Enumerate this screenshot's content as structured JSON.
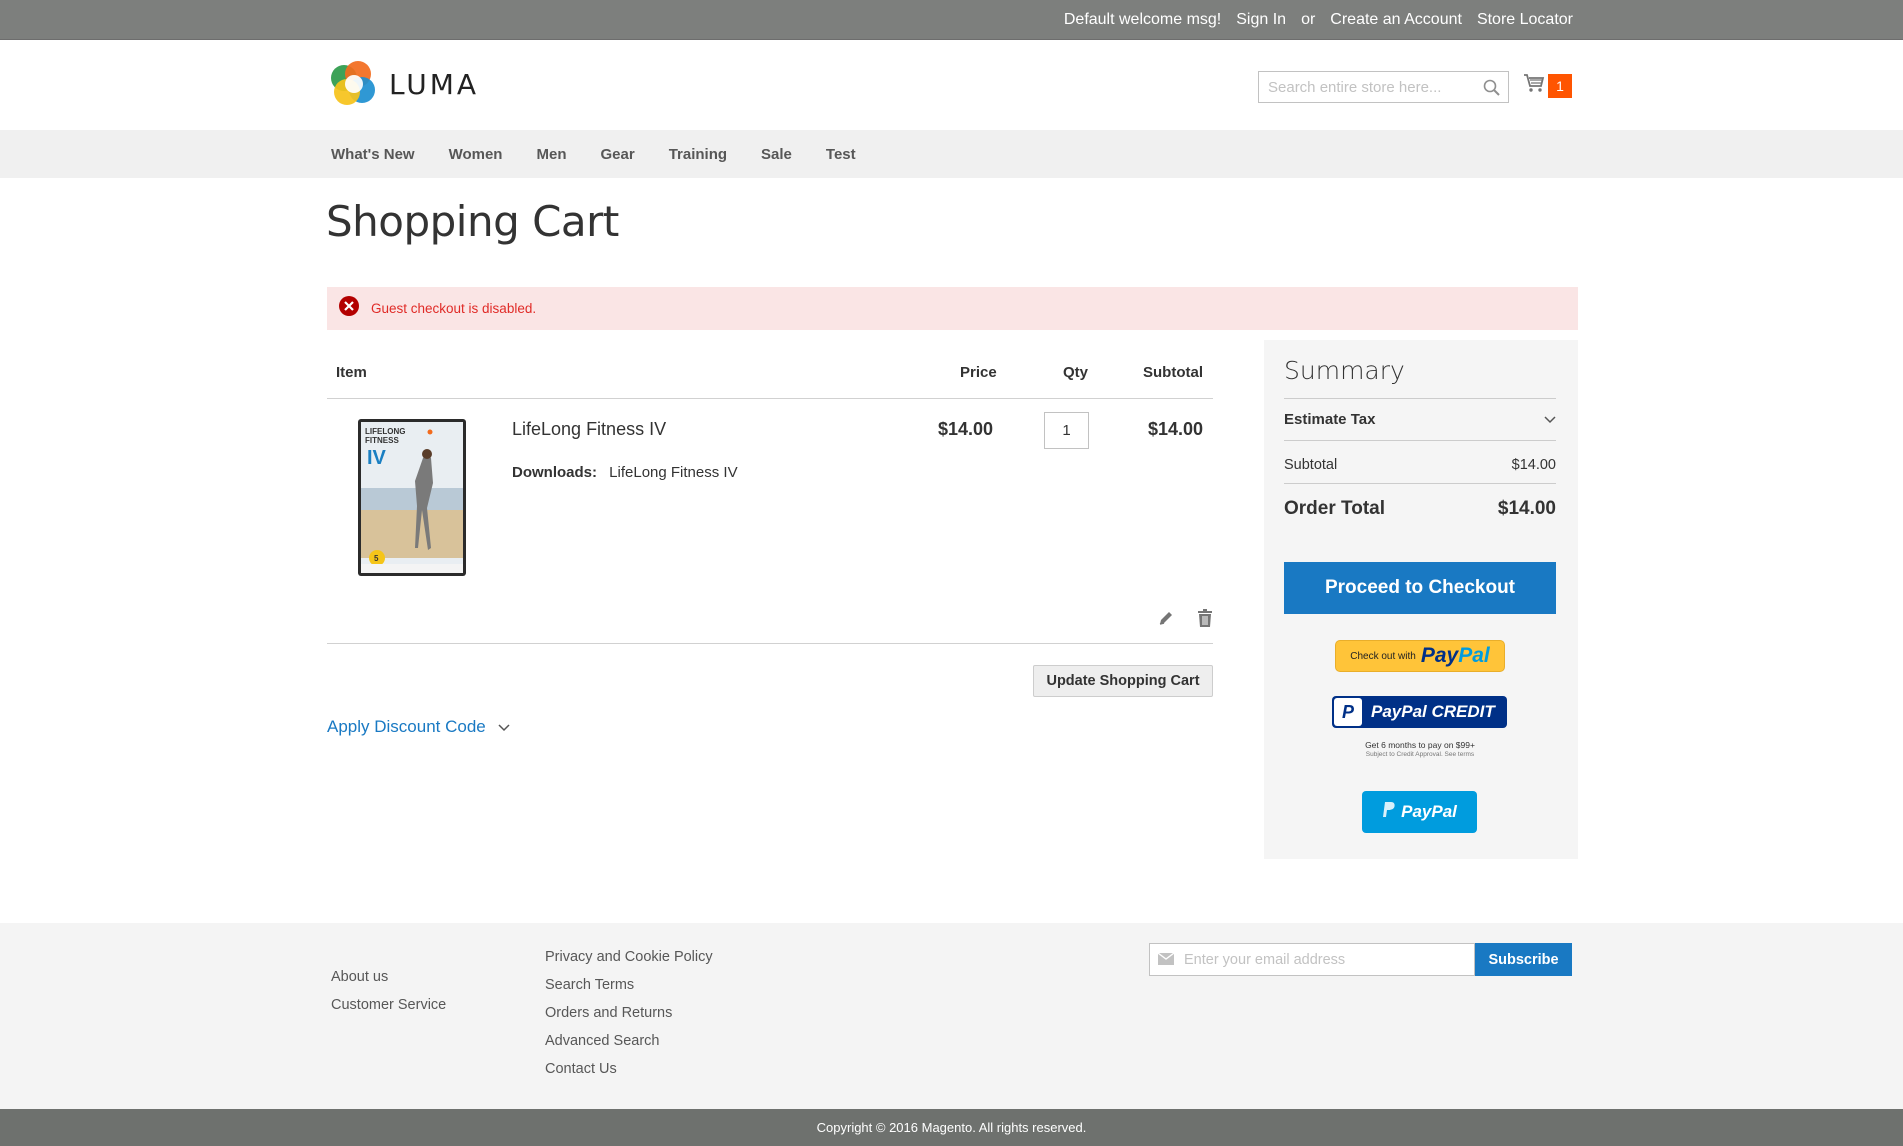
{
  "top_panel": {
    "welcome": "Default welcome msg!",
    "sign_in": "Sign In",
    "or": "or",
    "create_account": "Create an Account",
    "store_locator": "Store Locator"
  },
  "header": {
    "logo_text": "LUMA",
    "search_placeholder": "Search entire store here...",
    "cart_count": "1"
  },
  "nav": {
    "items": [
      "What's New",
      "Women",
      "Men",
      "Gear",
      "Training",
      "Sale",
      "Test"
    ]
  },
  "page": {
    "title": "Shopping Cart",
    "error_message": "Guest checkout is disabled."
  },
  "cart": {
    "headers": {
      "item": "Item",
      "price": "Price",
      "qty": "Qty",
      "subtotal": "Subtotal"
    },
    "items": [
      {
        "name": "LifeLong Fitness IV",
        "downloads_label": "Downloads:",
        "downloads_value": "LifeLong Fitness IV",
        "price": "$14.00",
        "qty": "1",
        "subtotal": "$14.00"
      }
    ],
    "update_label": "Update Shopping Cart",
    "discount_label": "Apply Discount Code"
  },
  "summary": {
    "title": "Summary",
    "estimate_tax": "Estimate Tax",
    "subtotal_label": "Subtotal",
    "subtotal_value": "$14.00",
    "order_total_label": "Order Total",
    "order_total_value": "$14.00",
    "checkout_label": "Proceed to Checkout",
    "paypal_checkout_small": "Check out with",
    "paypal_word_1": "Pay",
    "paypal_word_2": "Pal",
    "paypal_credit": "PayPal CREDIT",
    "paypal_credit_note": "Get 6 months to pay on $99+",
    "paypal_credit_subnote": "Subject to Credit Approval. See terms",
    "paypal_button": "PayPal"
  },
  "footer": {
    "col1": [
      "About us",
      "Customer Service"
    ],
    "col2": [
      "Privacy and Cookie Policy",
      "Search Terms",
      "Orders and Returns",
      "Advanced Search",
      "Contact Us"
    ],
    "email_placeholder": "Enter your email address",
    "subscribe": "Subscribe",
    "copyright": "Copyright © 2016 Magento. All rights reserved."
  },
  "colors": {
    "accent": "#1979c3",
    "error": "#e02b27",
    "badge": "#ff5501"
  }
}
